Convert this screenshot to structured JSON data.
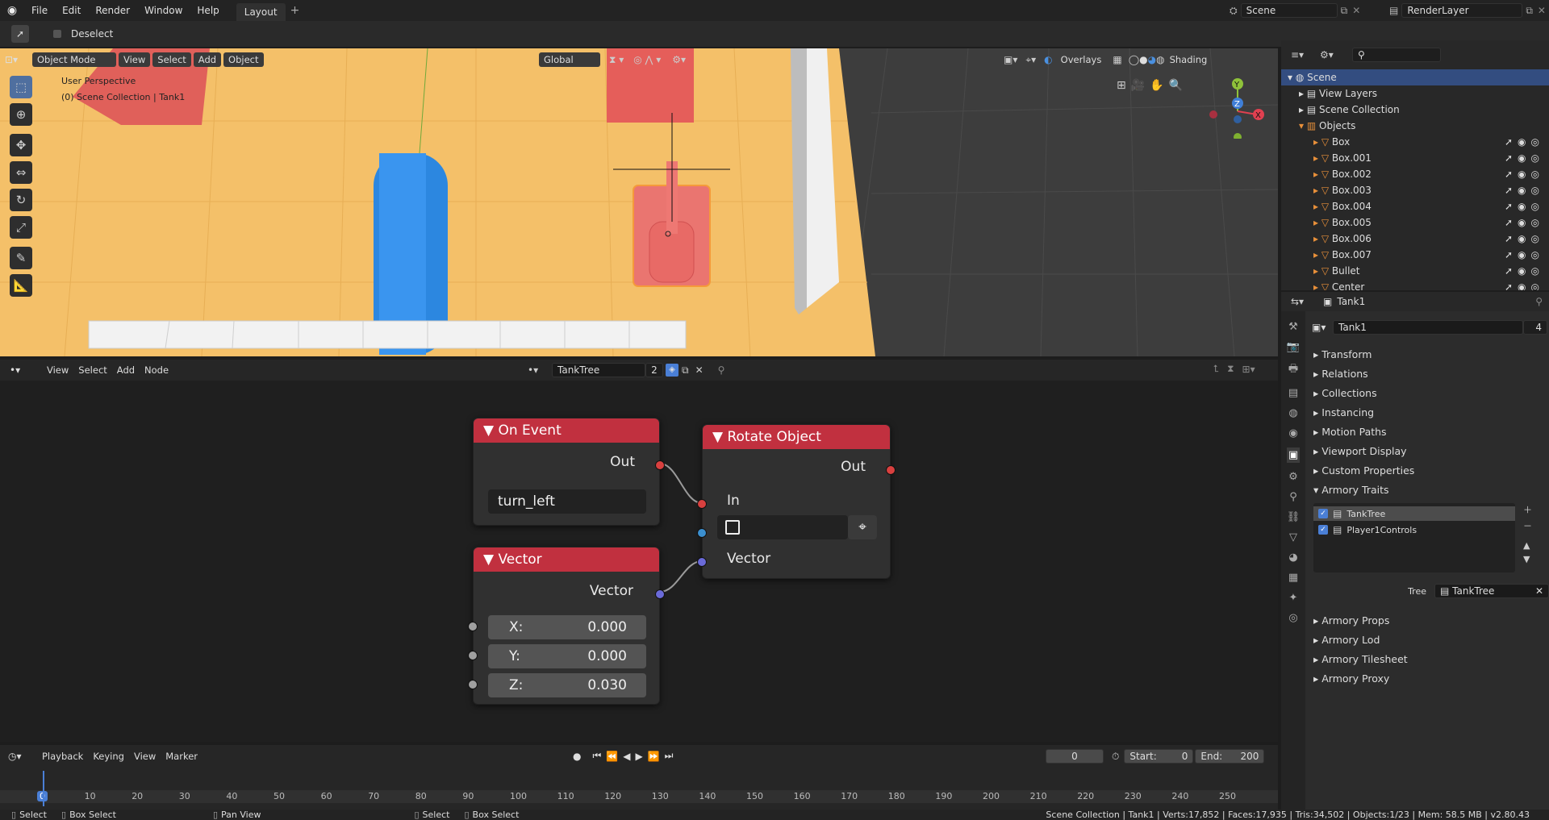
{
  "topbar": {
    "menus": [
      "File",
      "Edit",
      "Render",
      "Window",
      "Help"
    ],
    "workspace_tab": "Layout",
    "add_tab": "+",
    "scene_label": "Scene",
    "renderlayer_label": "RenderLayer"
  },
  "toolheader": {
    "deselect": "Deselect"
  },
  "viewport": {
    "mode": "Object Mode",
    "menus": [
      "View",
      "Select",
      "Add",
      "Object"
    ],
    "orientation": "Global",
    "overlays": "Overlays",
    "shading": "Shading",
    "perspective": "User Perspective",
    "collection_info": "(0) Scene Collection | Tank1",
    "gizmo_axes": {
      "y": "Y",
      "z": "Z",
      "x": "X"
    }
  },
  "node_editor": {
    "menus": [
      "View",
      "Select",
      "Add",
      "Node"
    ],
    "tree_name": "TankTree",
    "users": "2",
    "nodes": {
      "on_event": {
        "title": "On Event",
        "out": "Out",
        "value": "turn_left"
      },
      "rotate": {
        "title": "Rotate Object",
        "out": "Out",
        "in": "In",
        "vector": "Vector"
      },
      "vector": {
        "title": "Vector",
        "out": "Vector",
        "x_label": "X:",
        "x": "0.000",
        "y_label": "Y:",
        "y": "0.000",
        "z_label": "Z:",
        "z": "0.030"
      }
    }
  },
  "timeline": {
    "menus": [
      "Playback",
      "Keying",
      "View",
      "Marker"
    ],
    "current_frame": "0",
    "start_label": "Start:",
    "start": "0",
    "end_label": "End:",
    "end": "200",
    "ticks": [
      "0",
      "10",
      "20",
      "30",
      "40",
      "50",
      "60",
      "70",
      "80",
      "90",
      "100",
      "110",
      "120",
      "130",
      "140",
      "150",
      "160",
      "170",
      "180",
      "190",
      "200",
      "210",
      "220",
      "230",
      "240",
      "250"
    ]
  },
  "outliner": {
    "scene": "Scene",
    "view_layers": "View Layers",
    "scene_collection": "Scene Collection",
    "objects": "Objects",
    "items": [
      "Box",
      "Box.001",
      "Box.002",
      "Box.003",
      "Box.004",
      "Box.005",
      "Box.006",
      "Box.007",
      "Bullet",
      "Center"
    ]
  },
  "properties": {
    "header_object": "Tank1",
    "object_name": "Tank1",
    "users": "4",
    "panels": [
      "Transform",
      "Relations",
      "Collections",
      "Instancing",
      "Motion Paths",
      "Viewport Display",
      "Custom Properties"
    ],
    "armory_traits": "Armory Traits",
    "traits": [
      "TankTree",
      "Player1Controls"
    ],
    "tree_label": "Tree",
    "tree_value": "TankTree",
    "panels_after": [
      "Armory Props",
      "Armory Lod",
      "Armory Tilesheet",
      "Armory Proxy"
    ]
  },
  "statusbar": {
    "items": [
      "Select",
      "Box Select",
      "Pan View",
      "Select",
      "Box Select"
    ],
    "info": "Scene Collection | Tank1 | Verts:17,852 | Faces:17,935 | Tris:34,502 | Objects:1/23 | Mem: 58.5 MB | v2.80.43"
  }
}
